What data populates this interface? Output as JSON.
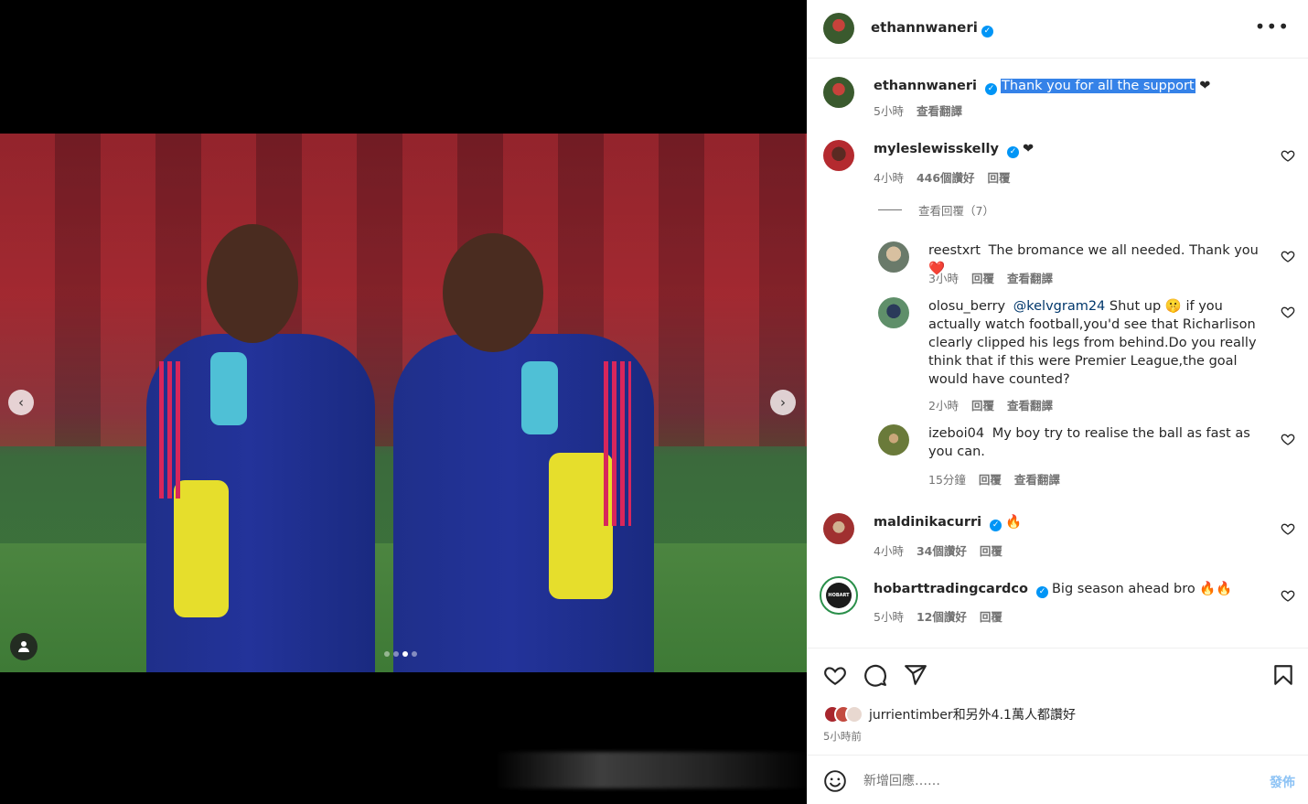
{
  "post": {
    "author": "ethannwaneri",
    "verified": true,
    "more_icon": "more-horizontal-icon",
    "media": {
      "slides": 4,
      "active_slide": 3,
      "prev_icon": "chevron-left-icon",
      "next_icon": "chevron-right-icon",
      "tag_icon": "user-tag-icon"
    }
  },
  "caption": {
    "user": "ethannwaneri",
    "text_highlighted": "Thank you for all the support",
    "text_suffix": " ❤",
    "time": "5小時",
    "translate": "查看翻譯"
  },
  "comments": [
    {
      "user": "myleslewisskelly",
      "verified": true,
      "text": "❤",
      "time": "4小時",
      "likes": "446個讚好",
      "reply": "回覆"
    }
  ],
  "view_replies": "查看回覆（7）",
  "replies": [
    {
      "user": "reestxrt",
      "text": "The bromance we all needed. Thank you ❤️",
      "time": "3小時",
      "reply": "回覆",
      "translate": "查看翻譯"
    },
    {
      "user": "olosu_berry",
      "mention": "@kelvgram24",
      "text": "Shut up 🤫 if you actually watch football,you'd see that Richarlison clearly clipped his legs from behind.Do you really think that if this were Premier League,the goal would have counted?",
      "time": "2小時",
      "reply": "回覆",
      "translate": "查看翻譯"
    },
    {
      "user": "izeboi04",
      "text": "My boy try to realise the ball as fast as you can.",
      "time": "15分鐘",
      "reply": "回覆",
      "translate": "查看翻譯"
    }
  ],
  "more_comments": [
    {
      "user": "maldinikacurri",
      "verified": true,
      "text": "🔥",
      "time": "4小時",
      "likes": "34個讚好",
      "reply": "回覆"
    },
    {
      "user": "hobarttradingcardco",
      "verified": true,
      "text": "Big season ahead bro 🔥🔥",
      "time": "5小時",
      "likes": "12個讚好",
      "reply": "回覆",
      "avatar_text": "HOBART"
    }
  ],
  "actions": {
    "like_icon": "heart-icon",
    "comment_icon": "comment-icon",
    "share_icon": "send-icon",
    "save_icon": "bookmark-icon"
  },
  "likes": {
    "user": "jurrientimber",
    "suffix": "和另外4.1萬人都讚好"
  },
  "posted_ago": "5小時前",
  "add_comment": {
    "emoji_icon": "emoji-icon",
    "placeholder": "新增回應……",
    "post_label": "發佈"
  }
}
